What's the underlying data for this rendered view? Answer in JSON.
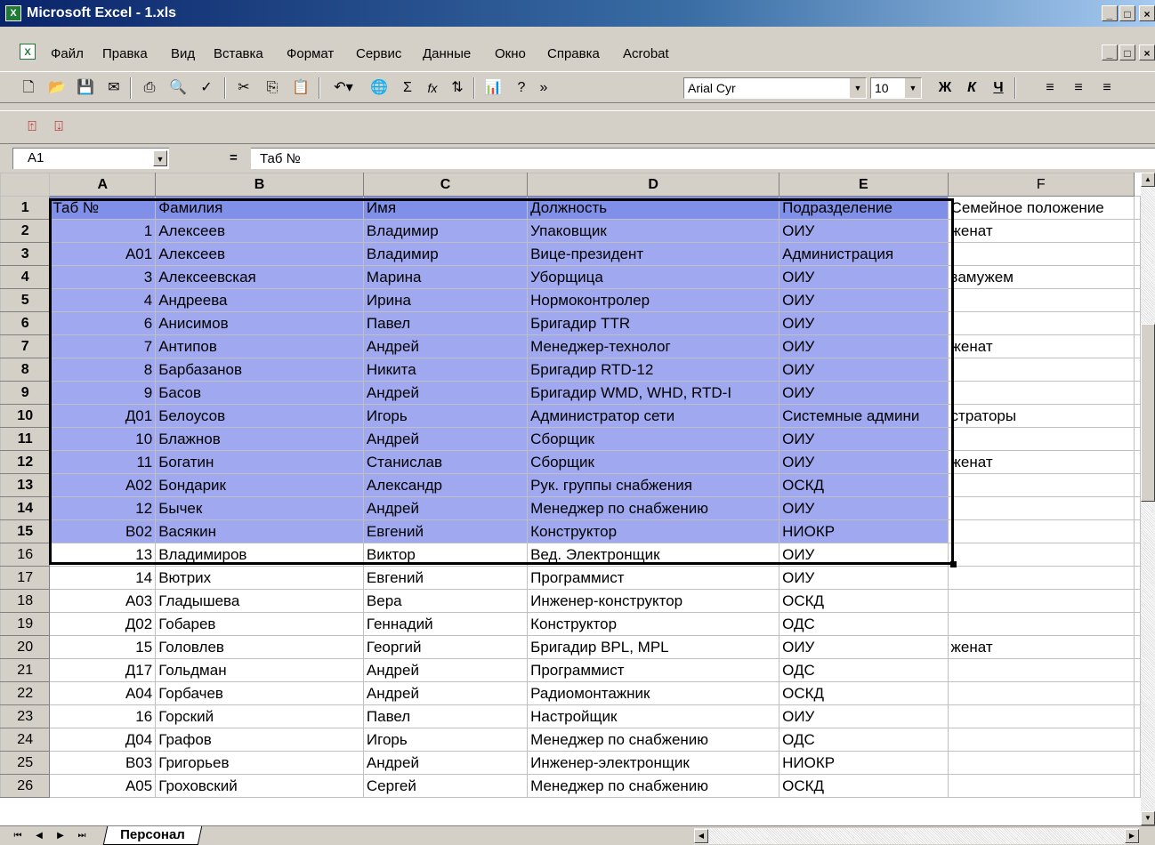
{
  "window": {
    "title": "Microsoft Excel - 1.xls",
    "min_label": "_",
    "max_label": "□",
    "close_label": "×"
  },
  "menu": [
    {
      "label": "Файл"
    },
    {
      "label": "Правка"
    },
    {
      "label": "Вид"
    },
    {
      "label": "Вставка"
    },
    {
      "label": "Формат"
    },
    {
      "label": "Сервис"
    },
    {
      "label": "Данные"
    },
    {
      "label": "Окно"
    },
    {
      "label": "Справка"
    },
    {
      "label": "Acrobat"
    }
  ],
  "toolbar": {
    "font_name": "Arial Cyr",
    "font_size": "10",
    "bold_label": "Ж",
    "italic_label": "К",
    "underline_label": "Ч",
    "sum_label": "Σ",
    "fx_label": "fx",
    "overflow_label": "»"
  },
  "formula_bar": {
    "name_box": "A1",
    "equals": "=",
    "content": "Таб №"
  },
  "columns": [
    "A",
    "B",
    "C",
    "D",
    "E",
    "F"
  ],
  "rows": [
    {
      "n": "1",
      "cells": [
        "Таб №",
        "Фамилия",
        "Имя",
        "Должность",
        "Подразделение",
        "Семейное положение"
      ]
    },
    {
      "n": "2",
      "cells": [
        "1",
        "Алексеев",
        "Владимир",
        "Упаковщик",
        "ОИУ",
        "женат"
      ]
    },
    {
      "n": "3",
      "cells": [
        "А01",
        "Алексеев",
        "Владимир",
        "Вице-президент",
        "Администрация",
        ""
      ]
    },
    {
      "n": "4",
      "cells": [
        "3",
        "Алексеевская",
        "Марина",
        "Уборщица",
        "ОИУ",
        "замужем"
      ]
    },
    {
      "n": "5",
      "cells": [
        "4",
        "Андреева",
        "Ирина",
        "Нормоконтролер",
        "ОИУ",
        ""
      ]
    },
    {
      "n": "6",
      "cells": [
        "6",
        "Анисимов",
        "Павел",
        "Бригадир TTR",
        "ОИУ",
        ""
      ]
    },
    {
      "n": "7",
      "cells": [
        "7",
        "Антипов",
        "Андрей",
        "Менеджер-технолог",
        "ОИУ",
        "женат"
      ]
    },
    {
      "n": "8",
      "cells": [
        "8",
        "Барбазанов",
        "Никита",
        "Бригадир RTD-12",
        "ОИУ",
        ""
      ]
    },
    {
      "n": "9",
      "cells": [
        "9",
        "Басов",
        "Андрей",
        "Бригадир WMD, WHD, RTD-I",
        "ОИУ",
        ""
      ]
    },
    {
      "n": "10",
      "cells": [
        "Д01",
        "Белоусов",
        "Игорь",
        "Администратор сети",
        "Системные админи",
        "страторы"
      ]
    },
    {
      "n": "11",
      "cells": [
        "10",
        "Блажнов",
        "Андрей",
        "Сборщик",
        "ОИУ",
        ""
      ]
    },
    {
      "n": "12",
      "cells": [
        "11",
        "Богатин",
        "Станислав",
        "Сборщик",
        "ОИУ",
        "женат"
      ]
    },
    {
      "n": "13",
      "cells": [
        "А02",
        "Бондарик",
        "Александр",
        "Рук. группы снабжения",
        "ОСКД",
        ""
      ]
    },
    {
      "n": "14",
      "cells": [
        "12",
        "Бычек",
        "Андрей",
        "Менеджер по снабжению",
        "ОИУ",
        ""
      ]
    },
    {
      "n": "15",
      "cells": [
        "В02",
        "Васякин",
        "Евгений",
        "Конструктор",
        "НИОКР",
        ""
      ]
    },
    {
      "n": "16",
      "cells": [
        "13",
        "Владимиров",
        "Виктор",
        "Вед. Электронщик",
        "ОИУ",
        ""
      ]
    },
    {
      "n": "17",
      "cells": [
        "14",
        "Вютрих",
        "Евгений",
        "Программист",
        "ОИУ",
        ""
      ]
    },
    {
      "n": "18",
      "cells": [
        "А03",
        "Гладышева",
        "Вера",
        "Инженер-конструктор",
        "ОСКД",
        ""
      ]
    },
    {
      "n": "19",
      "cells": [
        "Д02",
        "Гобарев",
        "Геннадий",
        "Конструктор",
        "ОДС",
        ""
      ]
    },
    {
      "n": "20",
      "cells": [
        "15",
        "Головлев",
        "Георгий",
        "Бригадир BPL, MPL",
        "ОИУ",
        "женат"
      ]
    },
    {
      "n": "21",
      "cells": [
        "Д17",
        "Гольдман",
        "Андрей",
        "Программист",
        "ОДС",
        ""
      ]
    },
    {
      "n": "22",
      "cells": [
        "А04",
        "Горбачев",
        "Андрей",
        "Радиомонтажник",
        "ОСКД",
        ""
      ]
    },
    {
      "n": "23",
      "cells": [
        "16",
        "Горский",
        "Павел",
        "Настройщик",
        "ОИУ",
        ""
      ]
    },
    {
      "n": "24",
      "cells": [
        "Д04",
        "Графов",
        "Игорь",
        "Менеджер по снабжению",
        "ОДС",
        ""
      ]
    },
    {
      "n": "25",
      "cells": [
        "В03",
        "Григорьев",
        "Андрей",
        "Инженер-электронщик",
        "НИОКР",
        ""
      ]
    },
    {
      "n": "26",
      "cells": [
        "А05",
        "Гроховский",
        "Сергей",
        "Менеджер по снабжению",
        "ОСКД",
        ""
      ]
    }
  ],
  "sheet_tab": "Персонал",
  "colors": {
    "selection": "#a0a8f0",
    "header_selection": "#8090e8"
  }
}
